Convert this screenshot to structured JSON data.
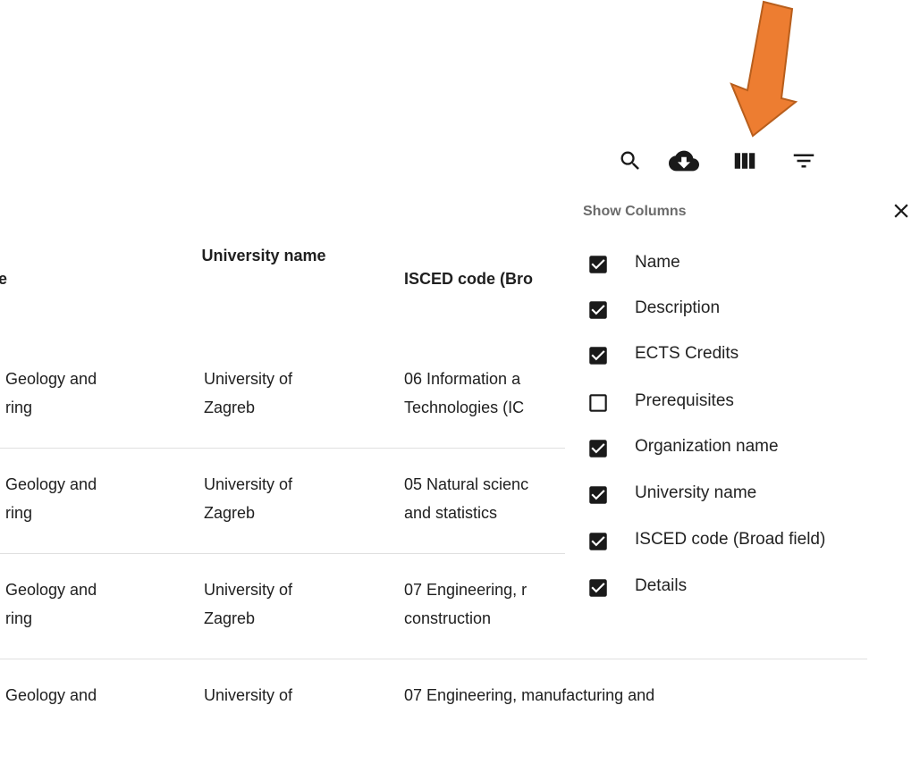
{
  "toolbar": {
    "icons": [
      "search-icon",
      "cloud-download-icon",
      "view-columns-icon",
      "filter-list-icon"
    ]
  },
  "table": {
    "headers": {
      "organization_partial": "e",
      "university": "University name",
      "isced_partial": "ISCED code (Bro"
    },
    "rows": [
      {
        "org_line1": "Geology and",
        "org_line2": "ring",
        "univ_line1": "University of",
        "univ_line2": "Zagreb",
        "isced_line1": "06 Information a",
        "isced_line2": "Technologies (IC"
      },
      {
        "org_line1": "Geology and",
        "org_line2": "ring",
        "univ_line1": "University of",
        "univ_line2": "Zagreb",
        "isced_line1": "05 Natural scienc",
        "isced_line2": "and statistics"
      },
      {
        "org_line1": "Geology and",
        "org_line2": "ring",
        "univ_line1": "University of",
        "univ_line2": "Zagreb",
        "isced_line1": "07 Engineering, r",
        "isced_line2": "construction"
      },
      {
        "org_line1": "Geology and",
        "univ_line1": "University of",
        "isced_line1": "07 Engineering, manufacturing and"
      }
    ]
  },
  "show_columns": {
    "title": "Show Columns",
    "options": [
      {
        "label": "Name",
        "checked": true
      },
      {
        "label": "Description",
        "checked": true
      },
      {
        "label": "ECTS Credits",
        "checked": true
      },
      {
        "label": "Prerequisites",
        "checked": false
      },
      {
        "label": "Organization name",
        "checked": true
      },
      {
        "label": "University name",
        "checked": true
      },
      {
        "label": "ISCED code (Broad field)",
        "checked": true
      },
      {
        "label": "Details",
        "checked": true
      }
    ]
  },
  "colors": {
    "arrow": "#ED7D31",
    "arrow_border": "#B85E1C",
    "checkbox": "#1a1a1a"
  }
}
